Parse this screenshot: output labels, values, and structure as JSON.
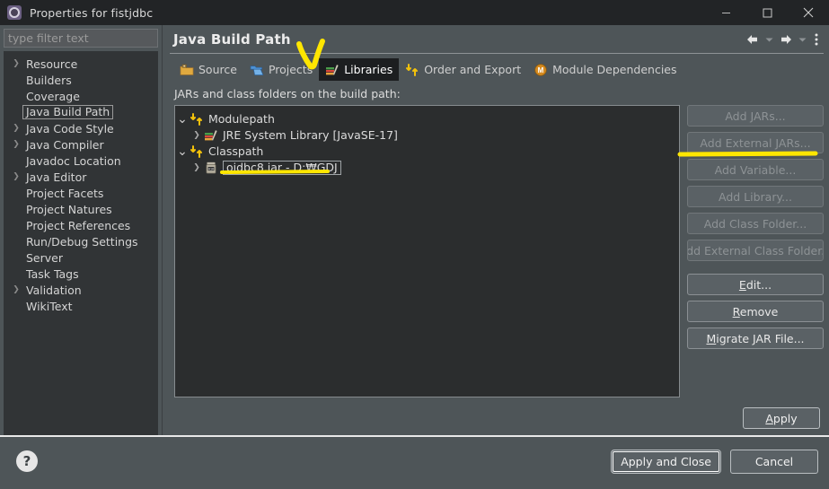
{
  "window": {
    "title": "Properties for fistjdbc",
    "icon": "gear-icon",
    "minimize_label": "—",
    "maximize_label": "□",
    "close_label": "✕"
  },
  "sidebar": {
    "filter": {
      "value": "",
      "placeholder": "type filter text"
    },
    "items": [
      {
        "label": "Resource",
        "expandable": true,
        "selected": false
      },
      {
        "label": "Builders",
        "expandable": false,
        "selected": false
      },
      {
        "label": "Coverage",
        "expandable": false,
        "selected": false
      },
      {
        "label": "Java Build Path",
        "expandable": false,
        "selected": true
      },
      {
        "label": "Java Code Style",
        "expandable": true,
        "selected": false
      },
      {
        "label": "Java Compiler",
        "expandable": true,
        "selected": false
      },
      {
        "label": "Javadoc Location",
        "expandable": false,
        "selected": false
      },
      {
        "label": "Java Editor",
        "expandable": true,
        "selected": false
      },
      {
        "label": "Project Facets",
        "expandable": false,
        "selected": false
      },
      {
        "label": "Project Natures",
        "expandable": false,
        "selected": false
      },
      {
        "label": "Project References",
        "expandable": false,
        "selected": false
      },
      {
        "label": "Run/Debug Settings",
        "expandable": false,
        "selected": false
      },
      {
        "label": "Server",
        "expandable": false,
        "selected": false
      },
      {
        "label": "Task Tags",
        "expandable": false,
        "selected": false
      },
      {
        "label": "Validation",
        "expandable": true,
        "selected": false
      },
      {
        "label": "WikiText",
        "expandable": false,
        "selected": false
      }
    ]
  },
  "page": {
    "title": "Java Build Path",
    "toolbar": {
      "back_icon": "back-arrow-icon",
      "back_dropdown_icon": "chevron-down-icon",
      "forward_icon": "forward-arrow-icon",
      "forward_dropdown_icon": "chevron-down-icon",
      "menu_icon": "vertical-dots-icon"
    },
    "tabs": [
      {
        "label": "Source",
        "icon": "package-folder-icon",
        "active": false
      },
      {
        "label": "Projects",
        "icon": "open-folder-icon",
        "active": false
      },
      {
        "label": "Libraries",
        "icon": "books-icon",
        "active": true
      },
      {
        "label": "Order and Export",
        "icon": "arrows-updown-icon",
        "active": false
      },
      {
        "label": "Module Dependencies",
        "icon": "module-m-icon",
        "active": false
      }
    ],
    "section_label": "JARs and class folders on the build path:",
    "tree": [
      {
        "label": "Modulepath",
        "icon": "arrows-updown-icon",
        "depth": 0,
        "twisty": "open",
        "boxed": false
      },
      {
        "label": "JRE System Library [JavaSE-17]",
        "icon": "books-icon",
        "depth": 1,
        "twisty": "closed",
        "boxed": false
      },
      {
        "label": "Classpath",
        "icon": "arrows-updown-icon",
        "depth": 0,
        "twisty": "open",
        "boxed": false
      },
      {
        "label": "ojdbc8.jar - D:₩GDJ",
        "icon": "jar-icon",
        "depth": 1,
        "twisty": "closed",
        "boxed": true
      }
    ],
    "buttons": [
      {
        "label": "Add JARs...",
        "disabled": true,
        "mnemonic": ""
      },
      {
        "label": "Add External JARs...",
        "disabled": true,
        "mnemonic": ""
      },
      {
        "label": "Add Variable...",
        "disabled": true,
        "mnemonic": ""
      },
      {
        "label": "Add Library...",
        "disabled": true,
        "mnemonic": ""
      },
      {
        "label": "Add Class Folder...",
        "disabled": true,
        "mnemonic": ""
      },
      {
        "label": "Add External Class Folder...",
        "disabled": true,
        "mnemonic": ""
      },
      {
        "label": "Edit...",
        "disabled": false,
        "mnemonic": "E"
      },
      {
        "label": "Remove",
        "disabled": false,
        "mnemonic": "R"
      },
      {
        "label": "Migrate JAR File...",
        "disabled": false,
        "mnemonic": "M"
      }
    ],
    "apply_label": "Apply"
  },
  "footer": {
    "help_icon": "question-mark-icon",
    "help_label": "?",
    "apply_and_close_label": "Apply and Close",
    "cancel_label": "Cancel"
  },
  "annotations": {
    "color": "#FFE600",
    "checkmark_target": "Libraries tab",
    "underline_targets": [
      "Add External JARs... button",
      "ojdbc8.jar - D:₩GDJ tree item"
    ]
  },
  "colors": {
    "titlebar_bg": "#222426",
    "dialog_bg": "#4e5558",
    "tree_bg": "#2b2d2e",
    "nav_bg": "#313436",
    "active_tab_bg": "#1c1e20",
    "text": "#dcdcdc",
    "annotation_yellow": "#FFE600"
  }
}
